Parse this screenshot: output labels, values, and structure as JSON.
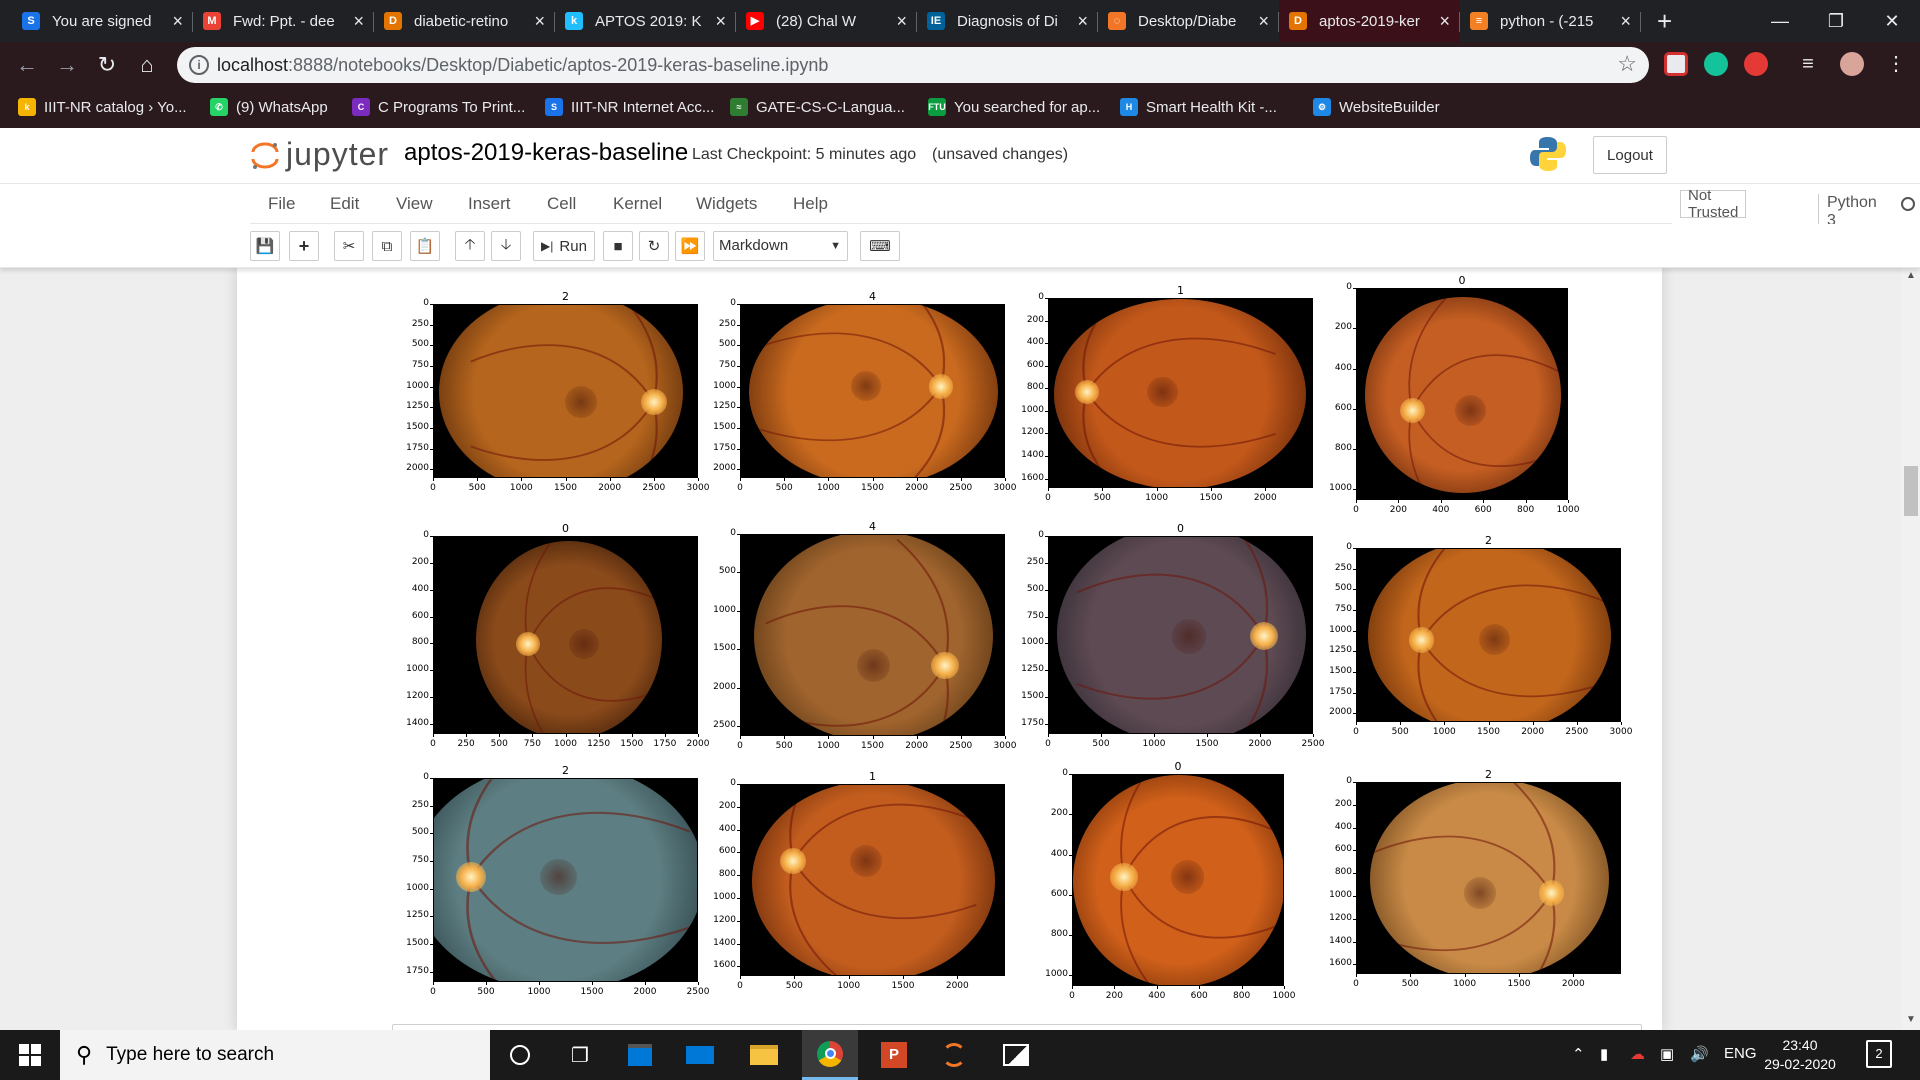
{
  "browser": {
    "tabs": [
      {
        "title": "You are signed",
        "color": "#1a73e8",
        "glyph": "S"
      },
      {
        "title": "Fwd: Ppt. - dee",
        "color": "#ea4335",
        "glyph": "M"
      },
      {
        "title": "diabetic-retino",
        "color": "#e37400",
        "glyph": "D"
      },
      {
        "title": "APTOS 2019: K",
        "color": "#20beff",
        "glyph": "k"
      },
      {
        "title": "(28) Chal W",
        "color": "#ff0000",
        "glyph": "▶"
      },
      {
        "title": "Diagnosis of Di",
        "color": "#00629b",
        "glyph": "IE"
      },
      {
        "title": "Desktop/Diabe",
        "color": "#f37626",
        "glyph": "◌"
      },
      {
        "title": "aptos-2019-ker",
        "color": "#e37400",
        "glyph": "D"
      },
      {
        "title": "python - (-215",
        "color": "#f48024",
        "glyph": "≡"
      }
    ],
    "active_tab": 7,
    "url_host": "localhost",
    "url_path": ":8888/notebooks/Desktop/Diabetic/aptos-2019-keras-baseline.ipynb",
    "bookmarks": [
      {
        "label": "IIIT-NR catalog › Yo...",
        "color": "#f4b400",
        "glyph": "k"
      },
      {
        "label": "(9) WhatsApp",
        "color": "#25d366",
        "glyph": "✆"
      },
      {
        "label": "C Programs To Print...",
        "color": "#7b2cbf",
        "glyph": "C"
      },
      {
        "label": "IIIT-NR Internet Acc...",
        "color": "#1a73e8",
        "glyph": "S"
      },
      {
        "label": "GATE-CS-C-Langua...",
        "color": "#2e7d32",
        "glyph": "≈"
      },
      {
        "label": "You searched for ap...",
        "color": "#0a9c3f",
        "glyph": "FTU"
      },
      {
        "label": "Smart Health Kit -...",
        "color": "#1e88e5",
        "glyph": "H"
      },
      {
        "label": "WebsiteBuilder",
        "color": "#1e88e5",
        "glyph": "⚙"
      }
    ]
  },
  "jupyter": {
    "logo_text": "jupyter",
    "notebook_name": "aptos-2019-keras-baseline",
    "checkpoint": "Last Checkpoint: 5 minutes ago",
    "unsaved": "(unsaved changes)",
    "logout_label": "Logout",
    "menu": [
      "File",
      "Edit",
      "View",
      "Insert",
      "Cell",
      "Kernel",
      "Widgets",
      "Help"
    ],
    "not_trusted": "Not Trusted",
    "kernel": "Python 3",
    "run_label": "Run",
    "cell_type": "Markdown"
  },
  "plots": [
    {
      "title": "2",
      "xticks": [
        "0",
        "500",
        "1000",
        "1500",
        "2000",
        "2500",
        "3000"
      ],
      "yticks": [
        "0",
        "250",
        "500",
        "750",
        "1000",
        "1250",
        "1500",
        "1750",
        "2000"
      ],
      "tint": "#b5651d",
      "edge": "#3d1a06"
    },
    {
      "title": "4",
      "xticks": [
        "0",
        "500",
        "1000",
        "1500",
        "2000",
        "2500",
        "3000"
      ],
      "yticks": [
        "0",
        "250",
        "500",
        "750",
        "1000",
        "1250",
        "1500",
        "1750",
        "2000"
      ],
      "tint": "#c96a1f",
      "edge": "#4a1c05"
    },
    {
      "title": "1",
      "xticks": [
        "0",
        "500",
        "1000",
        "1500",
        "2000"
      ],
      "yticks": [
        "0",
        "200",
        "400",
        "600",
        "800",
        "1000",
        "1200",
        "1400",
        "1600"
      ],
      "tint": "#c2581a",
      "edge": "#4a1803"
    },
    {
      "title": "0",
      "xticks": [
        "0",
        "200",
        "400",
        "600",
        "800",
        "1000"
      ],
      "yticks": [
        "0",
        "200",
        "400",
        "600",
        "800",
        "1000"
      ],
      "tint": "#c45e22",
      "edge": "#3b1104"
    },
    {
      "title": "0",
      "xticks": [
        "0",
        "250",
        "500",
        "750",
        "1000",
        "1250",
        "1500",
        "1750",
        "2000"
      ],
      "yticks": [
        "0",
        "200",
        "400",
        "600",
        "800",
        "1000",
        "1200",
        "1400"
      ],
      "tint": "#8a4a1a",
      "edge": "#1e0b02"
    },
    {
      "title": "4",
      "xticks": [
        "0",
        "500",
        "1000",
        "1500",
        "2000",
        "2500",
        "3000"
      ],
      "yticks": [
        "0",
        "500",
        "1000",
        "1500",
        "2000",
        "2500"
      ],
      "tint": "#a0642e",
      "edge": "#3a2208"
    },
    {
      "title": "0",
      "xticks": [
        "0",
        "500",
        "1000",
        "1500",
        "2000",
        "2500"
      ],
      "yticks": [
        "0",
        "250",
        "500",
        "750",
        "1000",
        "1250",
        "1500",
        "1750"
      ],
      "tint": "#5e4a52",
      "edge": "#1c1c26"
    },
    {
      "title": "2",
      "xticks": [
        "0",
        "500",
        "1000",
        "1500",
        "2000",
        "2500",
        "3000"
      ],
      "yticks": [
        "0",
        "250",
        "500",
        "750",
        "1000",
        "1250",
        "1500",
        "1750",
        "2000"
      ],
      "tint": "#c2661c",
      "edge": "#4a1d03"
    },
    {
      "title": "2",
      "xticks": [
        "0",
        "500",
        "1000",
        "1500",
        "2000",
        "2500"
      ],
      "yticks": [
        "0",
        "250",
        "500",
        "750",
        "1000",
        "1250",
        "1500",
        "1750"
      ],
      "tint": "#5d7e82",
      "edge": "#1d2e33"
    },
    {
      "title": "1",
      "xticks": [
        "0",
        "500",
        "1000",
        "1500",
        "2000"
      ],
      "yticks": [
        "0",
        "200",
        "400",
        "600",
        "800",
        "1000",
        "1200",
        "1400",
        "1600"
      ],
      "tint": "#c25d1e",
      "edge": "#4a1803"
    },
    {
      "title": "0",
      "xticks": [
        "0",
        "200",
        "400",
        "600",
        "800",
        "1000"
      ],
      "yticks": [
        "0",
        "200",
        "400",
        "600",
        "800",
        "1000"
      ],
      "tint": "#d0601a",
      "edge": "#501b02"
    },
    {
      "title": "2",
      "xticks": [
        "0",
        "500",
        "1000",
        "1500",
        "2000"
      ],
      "yticks": [
        "0",
        "200",
        "400",
        "600",
        "800",
        "1000",
        "1200",
        "1400",
        "1600"
      ],
      "tint": "#c88a46",
      "edge": "#4a2a0c"
    }
  ],
  "taskbar": {
    "search_placeholder": "Type here to search",
    "language": "ENG",
    "time": "23:40",
    "date": "29-02-2020",
    "notifications": "2"
  }
}
